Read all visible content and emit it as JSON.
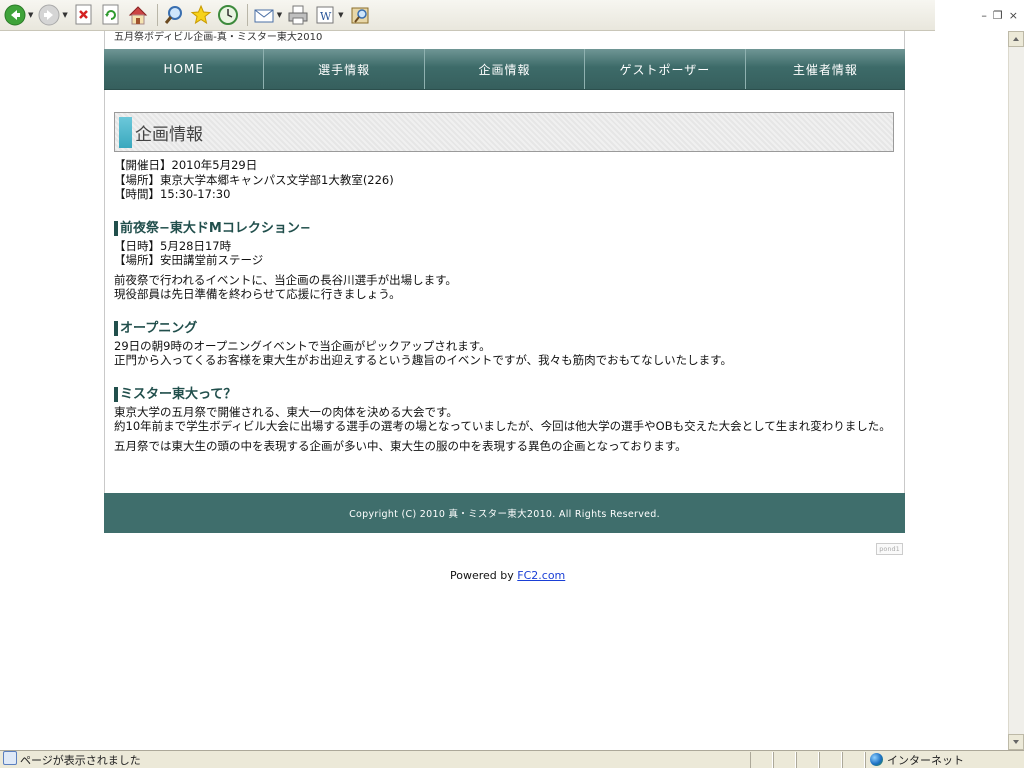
{
  "browser": {
    "toolbar_icons": [
      "back-icon",
      "forward-icon",
      "stop-icon",
      "refresh-icon",
      "home-icon",
      "search-icon",
      "favorites-icon",
      "history-icon",
      "mail-icon",
      "print-icon",
      "edit-icon",
      "research-icon"
    ],
    "window_controls": [
      "–",
      "❐",
      "×"
    ],
    "status": "ページが表示されました",
    "zone": "インターネット"
  },
  "site": {
    "subtitle": "五月祭ボディビル企画-真・ミスター東大2010",
    "nav": [
      "HOME",
      "選手情報",
      "企画情報",
      "ゲストポーザー",
      "主催者情報"
    ],
    "page_title": "企画情報",
    "info_lines": [
      "【開催日】2010年5月29日",
      "【場所】東京大学本郷キャンパス文学部1大教室(226)",
      "【時間】15:30-17:30"
    ],
    "sections": [
      {
        "title": "前夜祭−東大ドMコレクション−",
        "lines": [
          "【日時】5月28日17時",
          "【場所】安田講堂前ステージ"
        ],
        "paras": [
          "前夜祭で行われるイベントに、当企画の長谷川選手が出場します。",
          "現役部員は先日準備を終わらせて応援に行きましょう。"
        ]
      },
      {
        "title": "オープニング",
        "lines": [],
        "paras": [
          "29日の朝9時のオープニングイベントで当企画がピックアップされます。",
          "正門から入ってくるお客様を東大生がお出迎えするという趣旨のイベントですが、我々も筋肉でおもてなしいたします。"
        ]
      },
      {
        "title": "ミスター東大って？",
        "lines": [],
        "paras": [
          "東京大学の五月祭で開催される、東大一の肉体を決める大会です。",
          "約10年前まで学生ボディビル大会に出場する選手の選考の場となっていましたが、今回は他大学の選手やOBも交えた大会として生まれ変わりました。"
        ],
        "extra": "五月祭では東大生の頭の中を表現する企画が多い中、東大生の服の中を表現する異色の企画となっております。"
      }
    ],
    "footer": "Copyright (C) 2010 真・ミスター東大2010. All Rights Reserved.",
    "pond": "pond1",
    "powered_by": "Powered by",
    "powered_link": "FC2.com"
  }
}
